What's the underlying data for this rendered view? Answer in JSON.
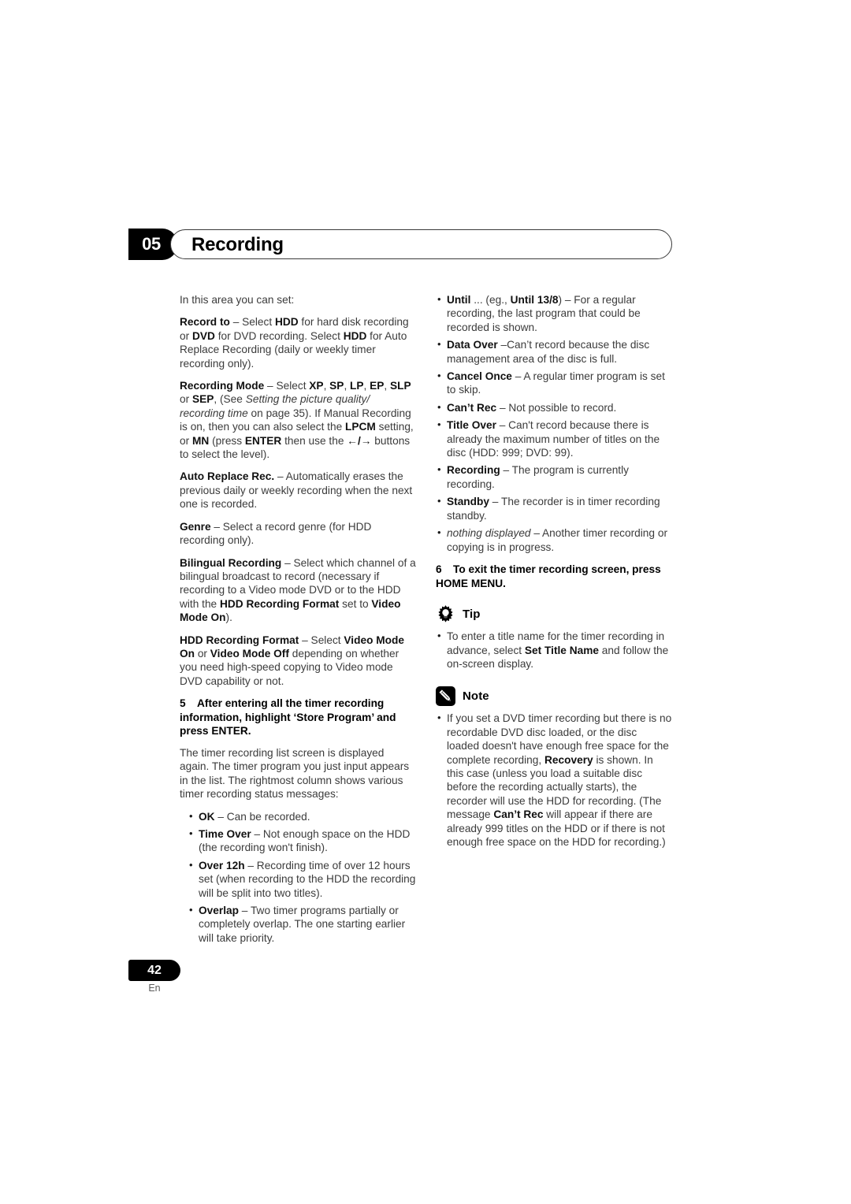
{
  "header": {
    "chapter_number": "05",
    "title": "Recording"
  },
  "footer": {
    "page_number": "42",
    "language": "En"
  },
  "left_column": {
    "intro": "In this area you can set:",
    "record_to": {
      "term": "Record to",
      "text_1": " – Select ",
      "b1": "HDD",
      "text_2": " for hard disk recording or ",
      "b2": "DVD",
      "text_3": " for DVD recording. Select ",
      "b3": "HDD",
      "text_4": "  for Auto Replace Recording (daily or weekly timer recording only)."
    },
    "recording_mode": {
      "term": "Recording Mode",
      "t1": " – Select ",
      "b_xp": "XP",
      "t2": ", ",
      "b_sp": "SP",
      "t3": ", ",
      "b_lp": "LP",
      "t4": ", ",
      "b_ep": "EP",
      "t5": ", ",
      "b_slp": "SLP",
      "t6": " or ",
      "b_sep": "SEP",
      "t7": ", (See ",
      "i1": "Setting the picture quality/ recording time",
      "t8": " on page 35). If Manual Recording is on, then you can also select the ",
      "b_lpcm": "LPCM",
      "t9": " setting, or ",
      "b_mn": "MN",
      "t10": " (press ",
      "b_enter": "ENTER",
      "t11": " then use the ",
      "arrows": "←/→",
      "t12": " buttons to select the level)."
    },
    "auto_replace": {
      "term": "Auto Replace Rec.",
      "text": " – Automatically erases the previous daily or weekly recording when the next one is recorded."
    },
    "genre": {
      "term": "Genre",
      "text": " – Select a record genre (for HDD recording only)."
    },
    "bilingual": {
      "term": "Bilingual Recording",
      "t1": " – Select which channel of a bilingual broadcast to record (necessary if recording to a Video mode DVD or to the HDD with the ",
      "b1": "HDD Recording Format",
      "t2": " set to ",
      "b2": "Video Mode On",
      "t3": ")."
    },
    "hdd_rec_format": {
      "term": "HDD Recording Format",
      "t1": " – Select ",
      "b1": "Video Mode On",
      "t2": " or ",
      "b2": "Video Mode Off",
      "t3": " depending on whether you need high-speed copying to Video mode DVD capability or not."
    },
    "step5": {
      "number": "5",
      "text": "After entering all the timer recording information, highlight ‘Store Program’ and press ENTER."
    },
    "step5_body": "The timer recording list screen is displayed again. The timer program you just input appears in the list. The rightmost column shows various timer recording status messages:",
    "status_bullets": [
      {
        "term": "OK",
        "text": " – Can be recorded."
      },
      {
        "term": "Time Over",
        "text": " – Not enough space on the HDD (the recording won't finish)."
      },
      {
        "term": "Over 12h",
        "text": " – Recording time of over 12 hours set (when recording to the HDD the recording will be split into two titles)."
      },
      {
        "term": "Overlap",
        "text": " – Two timer programs partially or completely overlap. The one starting earlier will take priority."
      }
    ]
  },
  "right_column": {
    "status_bullets_top": [
      {
        "term": "Until",
        "t1": " ... (eg., ",
        "term2": "Until 13/8",
        "t2": ") – For a regular recording, the last program that could be recorded is shown."
      }
    ],
    "status_bullets": [
      {
        "term": "Data Over",
        "text": " –Can’t record because the disc management area of the disc is full."
      },
      {
        "term": "Cancel Once",
        "text": " – A regular timer program is set to skip."
      },
      {
        "term": "Can’t Rec",
        "text": " – Not possible to record."
      },
      {
        "term": "Title Over",
        "text": " – Can't record because there is already the maximum number of titles on the disc (HDD: 999; DVD: 99)."
      },
      {
        "term": "Recording",
        "text": " – The program is currently recording."
      },
      {
        "term": "Standby",
        "text": " – The recorder is in timer recording standby."
      }
    ],
    "nothing_displayed": {
      "italic_term": "nothing displayed",
      "text": " – Another timer recording or copying is in progress."
    },
    "step6": {
      "number": "6",
      "text": "To exit the timer recording screen, press HOME MENU."
    },
    "tip": {
      "label": "Tip",
      "icon": "lightbulb-icon",
      "bullet": {
        "t1": "To enter a title name for the timer recording in advance, select ",
        "b1": "Set Title Name",
        "t2": " and follow the on-screen display."
      }
    },
    "note": {
      "label": "Note",
      "icon": "pencil-icon",
      "bullet": {
        "t1": "If you set a DVD timer recording but there is no recordable DVD disc loaded, or the disc loaded doesn't have enough free space for the complete recording, ",
        "b1": "Recovery",
        "t2": " is shown. In this case (unless you load a suitable disc before the recording actually starts), the recorder will use the HDD for recording. (The message ",
        "b2": "Can’t Rec",
        "t3": " will appear if there are already 999 titles on the HDD or if there is not enough free space on the HDD for recording.)"
      }
    }
  },
  "colors": {
    "ink": "#231f20",
    "body_text": "#3b3b3b",
    "accent_black": "#000000"
  }
}
